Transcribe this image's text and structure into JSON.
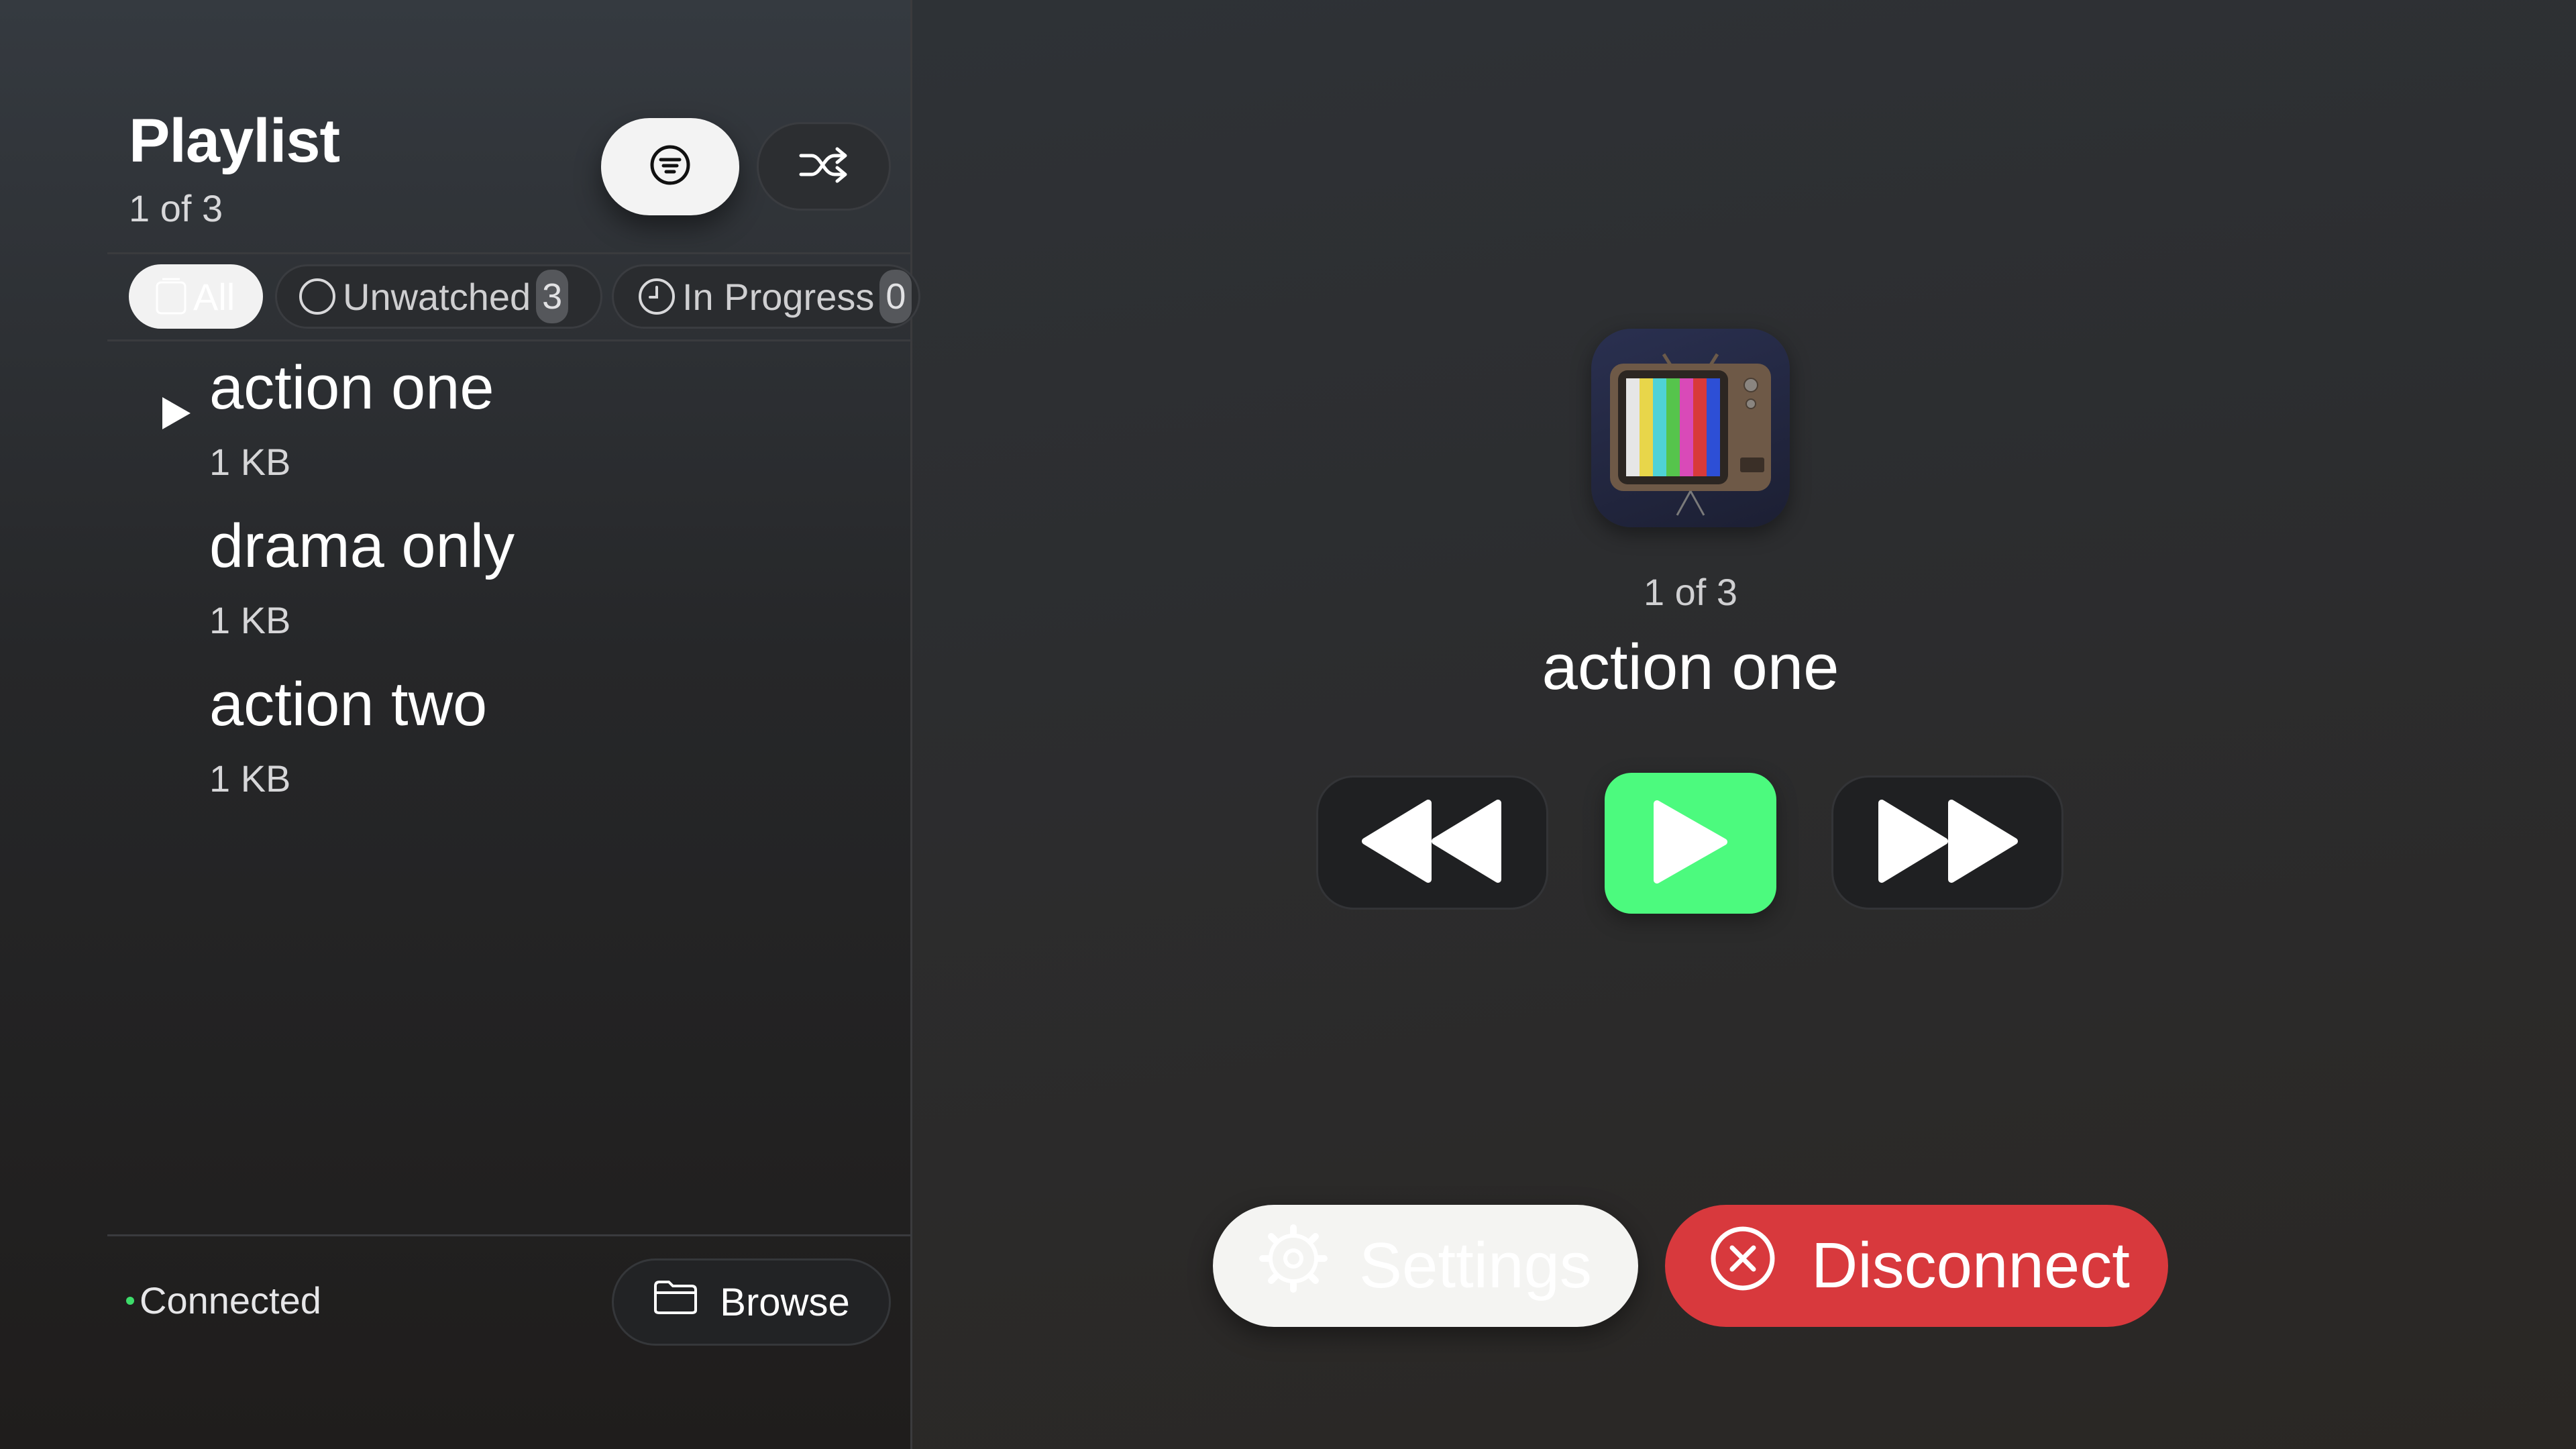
{
  "sidebar": {
    "title": "Playlist",
    "subtitle": "1 of 3",
    "filter_chips": [
      {
        "label": "All",
        "count": "",
        "selected": true
      },
      {
        "label": "Unwatched",
        "count": "3",
        "selected": false
      },
      {
        "label": "In Progress",
        "count": "0",
        "selected": false
      }
    ],
    "items": [
      {
        "title": "action one",
        "size": "1 KB",
        "playing": true
      },
      {
        "title": "drama only",
        "size": "1 KB",
        "playing": false
      },
      {
        "title": "action two",
        "size": "1 KB",
        "playing": false
      }
    ],
    "status": "Connected",
    "browse_label": "Browse"
  },
  "now_playing": {
    "position": "1 of 3",
    "title": "action one"
  },
  "actions": {
    "settings_label": "Settings",
    "disconnect_label": "Disconnect"
  },
  "colors": {
    "accent_green": "#4cfa7e",
    "disconnect_red": "#d8393d",
    "status_green": "#3ddc6a"
  },
  "icons": {
    "filter": "filter-lines-icon",
    "shuffle": "shuffle-icon",
    "all": "all-items-icon",
    "unwatched": "circle-icon",
    "in_progress": "clock-icon",
    "now_playing": "play-triangle-icon",
    "browse": "folder-icon",
    "app": "retro-tv-icon",
    "rewind": "rewind-icon",
    "play": "play-icon",
    "fast_forward": "fast-forward-icon",
    "settings": "gear-icon",
    "disconnect": "x-circle-icon"
  }
}
